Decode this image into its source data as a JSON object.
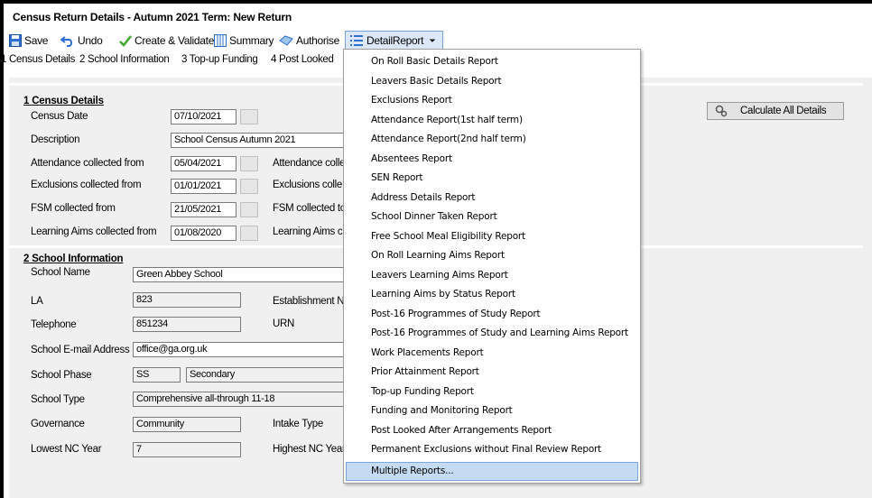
{
  "window": {
    "title": "Census Return Details - Autumn 2021 Term: New Return"
  },
  "toolbar": {
    "save": "Save",
    "undo": "Undo",
    "create_validate": "Create & Validate",
    "summary": "Summary",
    "authorise": "Authorise",
    "detail_report": "DetailReport"
  },
  "tabs": [
    "1 Census Details",
    "2 School Information",
    "3 Top-up Funding",
    "4 Post Looked"
  ],
  "census": {
    "heading": "1 Census Details",
    "census_date_label": "Census Date",
    "census_date": "07/10/2021",
    "description_label": "Description",
    "description": "School Census Autumn 2021",
    "attendance_from_label": "Attendance collected from",
    "attendance_from": "05/04/2021",
    "attendance_to_label": "Attendance colle",
    "exclusions_from_label": "Exclusions collected from",
    "exclusions_from": "01/01/2021",
    "exclusions_to_label": "Exclusions colle",
    "fsm_from_label": "FSM collected from",
    "fsm_from": "21/05/2021",
    "fsm_to_label": "FSM collected to",
    "learning_from_label": "Learning Aims collected from",
    "learning_from": "01/08/2020",
    "learning_to_label": "Learning Aims c"
  },
  "calculate_button": "Calculate All Details",
  "school": {
    "heading": "2 School Information",
    "name_label": "School Name",
    "name": "Green Abbey School",
    "la_label": "LA",
    "la": "823",
    "establishment_label": "Establishment N",
    "telephone_label": "Telephone",
    "telephone": "851234",
    "urn_label": "URN",
    "email_label": "School E-mail Address",
    "email": "office@ga.org.uk",
    "phase_label": "School Phase",
    "phase_code": "SS",
    "phase": "Secondary",
    "type_label": "School Type",
    "type": "Comprehensive all-through 11-18",
    "governance_label": "Governance",
    "governance": "Community",
    "intake_label": "Intake Type",
    "lowest_label": "Lowest NC Year",
    "lowest": "7",
    "highest_label": "Highest NC Year"
  },
  "menu": {
    "items": [
      "On Roll Basic Details Report",
      "Leavers Basic Details Report",
      "Exclusions Report",
      "Attendance Report(1st half term)",
      "Attendance Report(2nd half term)",
      "Absentees Report",
      "SEN Report",
      "Address Details Report",
      "School Dinner Taken Report",
      "Free School Meal Eligibility Report",
      "On Roll Learning Aims Report",
      "Leavers Learning Aims Report",
      "Learning Aims by Status Report",
      "Post-16 Programmes of Study Report",
      "Post-16 Programmes of Study and Learning Aims Report",
      "Work Placements Report",
      "Prior Attainment Report",
      "Top-up Funding Report",
      "Funding and Monitoring Report",
      "Post Looked After Arrangements Report",
      "Permanent Exclusions without Final Review Report"
    ],
    "highlighted": "Multiple Reports..."
  }
}
